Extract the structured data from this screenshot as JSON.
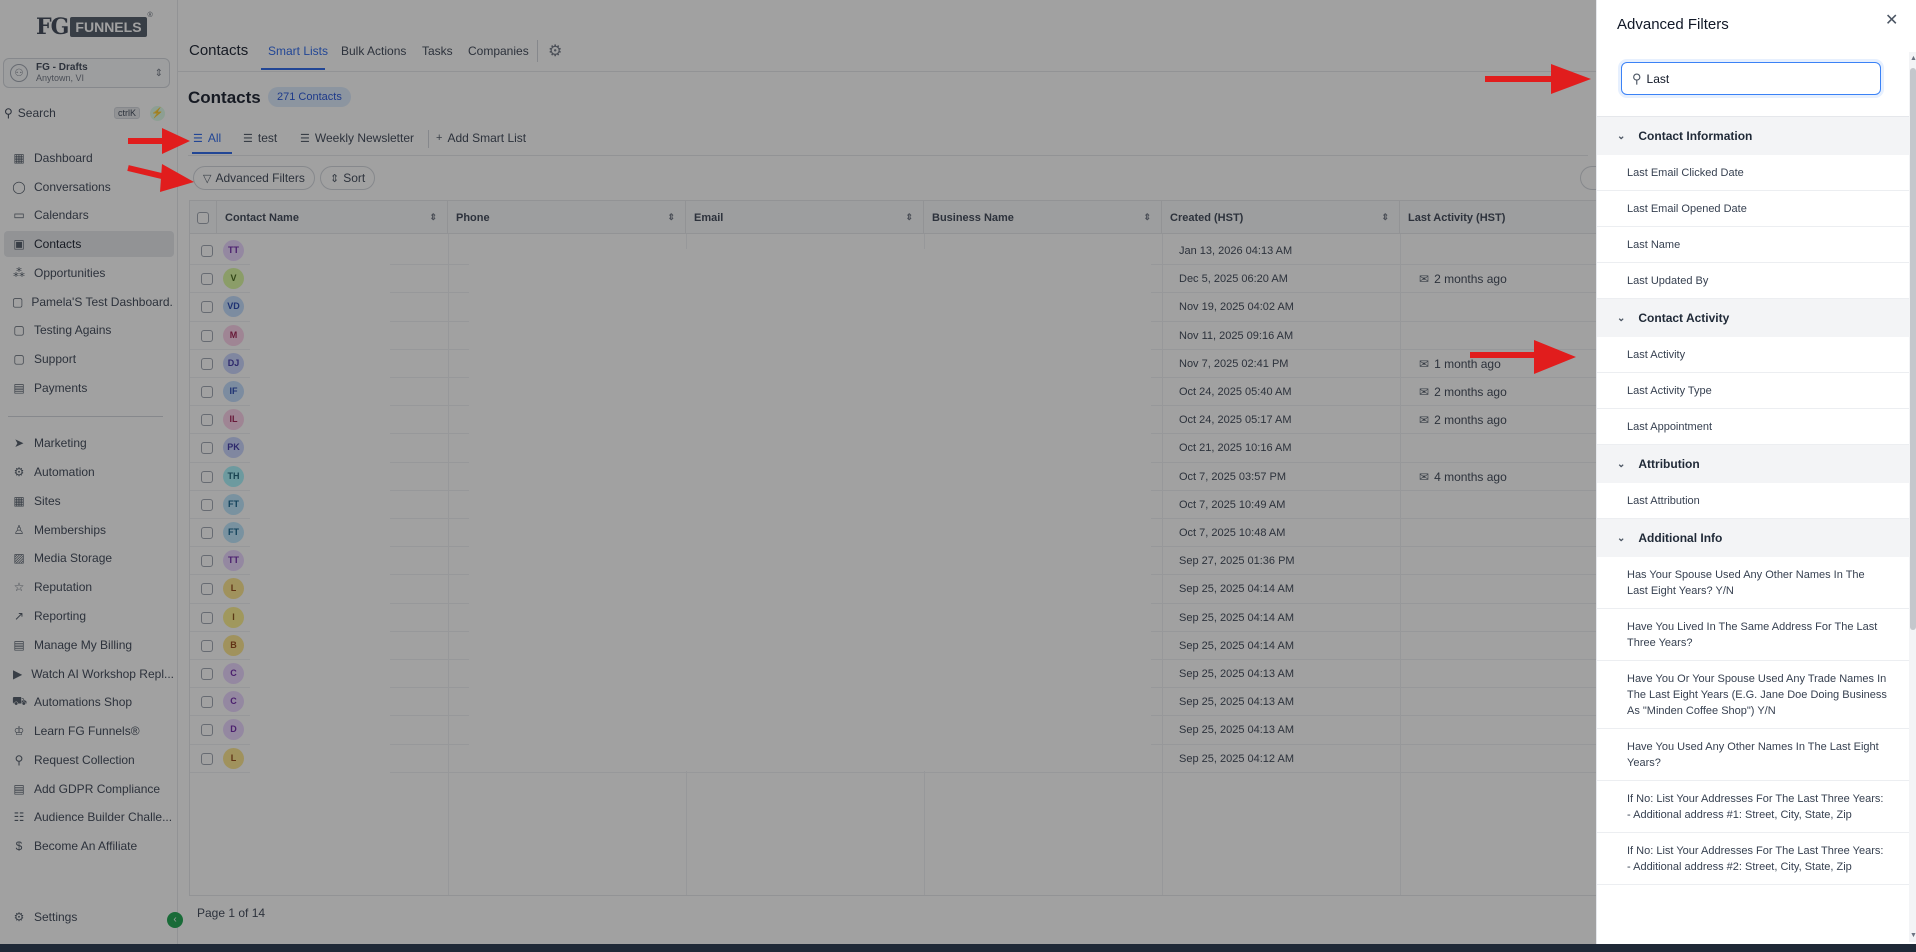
{
  "app": {
    "logo_fg": "FG",
    "logo_funnels": "FUNNELS",
    "logo_reg": "®"
  },
  "sidebar": {
    "account": {
      "name": "FG - Drafts",
      "location": "Anytown, VI"
    },
    "search": {
      "label": "Search",
      "shortcut": "ctrlK"
    },
    "items": [
      {
        "label": "Dashboard",
        "icon": "dashboard-icon",
        "glyph": "▦"
      },
      {
        "label": "Conversations",
        "icon": "chat-icon",
        "glyph": "◯"
      },
      {
        "label": "Calendars",
        "icon": "calendar-icon",
        "glyph": "▭"
      },
      {
        "label": "Contacts",
        "icon": "contacts-icon",
        "glyph": "▣"
      },
      {
        "label": "Opportunities",
        "icon": "opportunities-icon",
        "glyph": "⁂"
      },
      {
        "label": "Pamela'S Test Dashboard...",
        "icon": "custom-link-icon",
        "glyph": "▢"
      },
      {
        "label": "Testing Agains",
        "icon": "custom-link-icon",
        "glyph": "▢"
      },
      {
        "label": "Support",
        "icon": "custom-link-icon",
        "glyph": "▢"
      },
      {
        "label": "Payments",
        "icon": "payments-icon",
        "glyph": "▤"
      },
      {
        "label": "Marketing",
        "icon": "send-icon",
        "glyph": "➤"
      },
      {
        "label": "Automation",
        "icon": "automation-icon",
        "glyph": "⚙"
      },
      {
        "label": "Sites",
        "icon": "sites-icon",
        "glyph": "▦"
      },
      {
        "label": "Memberships",
        "icon": "memberships-icon",
        "glyph": "♙"
      },
      {
        "label": "Media Storage",
        "icon": "image-icon",
        "glyph": "▨"
      },
      {
        "label": "Reputation",
        "icon": "star-icon",
        "glyph": "☆"
      },
      {
        "label": "Reporting",
        "icon": "trend-icon",
        "glyph": "↗"
      },
      {
        "label": "Manage My Billing",
        "icon": "billing-icon",
        "glyph": "▤"
      },
      {
        "label": "Watch AI Workshop Repl...",
        "icon": "video-icon",
        "glyph": "▶"
      },
      {
        "label": "Automations Shop",
        "icon": "cart-icon",
        "glyph": "⛟"
      },
      {
        "label": "Learn FG Funnels®",
        "icon": "graduation-icon",
        "glyph": "♔"
      },
      {
        "label": "Request Collection",
        "icon": "location-icon",
        "glyph": "⚲"
      },
      {
        "label": "Add GDPR Compliance",
        "icon": "document-icon",
        "glyph": "▤"
      },
      {
        "label": "Audience Builder Challe...",
        "icon": "audience-icon",
        "glyph": "☷"
      },
      {
        "label": "Become An Affiliate",
        "icon": "dollar-icon",
        "glyph": "$"
      }
    ],
    "settings_label": "Settings"
  },
  "header": {
    "title": "Contacts",
    "tabs": [
      "Smart Lists",
      "Bulk Actions",
      "Tasks",
      "Companies"
    ]
  },
  "main": {
    "page_title": "Contacts",
    "count_badge": "271 Contacts",
    "smart_lists": [
      "All",
      "test",
      "Weekly Newsletter"
    ],
    "add_smart_list": "Add Smart List",
    "advanced_filters": "Advanced Filters",
    "sort": "Sort",
    "columns": [
      "Contact Name",
      "Phone",
      "Email",
      "Business Name",
      "Created (HST)",
      "Last Activity (HST)"
    ],
    "rows": [
      {
        "initials": "TT",
        "created": "Jan 13, 2026 04:13 AM",
        "activity": ""
      },
      {
        "initials": "V",
        "created": "Dec 5, 2025 06:20 AM",
        "activity": "2 months ago"
      },
      {
        "initials": "VD",
        "created": "Nov 19, 2025 04:02 AM",
        "activity": ""
      },
      {
        "initials": "M",
        "created": "Nov 11, 2025 09:16 AM",
        "activity": ""
      },
      {
        "initials": "DJ",
        "created": "Nov 7, 2025 02:41 PM",
        "activity": "1 month ago"
      },
      {
        "initials": "IF",
        "created": "Oct 24, 2025 05:40 AM",
        "activity": "2 months ago"
      },
      {
        "initials": "IL",
        "created": "Oct 24, 2025 05:17 AM",
        "activity": "2 months ago"
      },
      {
        "initials": "PK",
        "created": "Oct 21, 2025 10:16 AM",
        "activity": ""
      },
      {
        "initials": "TH",
        "created": "Oct 7, 2025 03:57 PM",
        "activity": "4 months ago"
      },
      {
        "initials": "FT",
        "created": "Oct 7, 2025 10:49 AM",
        "activity": ""
      },
      {
        "initials": "FT",
        "created": "Oct 7, 2025 10:48 AM",
        "activity": ""
      },
      {
        "initials": "TT",
        "created": "Sep 27, 2025 01:36 PM",
        "activity": ""
      },
      {
        "initials": "L",
        "created": "Sep 25, 2025 04:14 AM",
        "activity": ""
      },
      {
        "initials": "I",
        "created": "Sep 25, 2025 04:14 AM",
        "activity": ""
      },
      {
        "initials": "B",
        "created": "Sep 25, 2025 04:14 AM",
        "activity": ""
      },
      {
        "initials": "C",
        "created": "Sep 25, 2025 04:13 AM",
        "activity": ""
      },
      {
        "initials": "C",
        "created": "Sep 25, 2025 04:13 AM",
        "activity": ""
      },
      {
        "initials": "D",
        "created": "Sep 25, 2025 04:13 AM",
        "activity": ""
      },
      {
        "initials": "L",
        "created": "Sep 25, 2025 04:12 AM",
        "activity": ""
      }
    ],
    "pager": "Page 1 of 14"
  },
  "panel": {
    "title": "Advanced Filters",
    "search_value": "Last",
    "groups": [
      {
        "label": "Contact Information",
        "options": [
          "Last Email Clicked Date",
          "Last Email Opened Date",
          "Last Name",
          "Last Updated By"
        ]
      },
      {
        "label": "Contact Activity",
        "options": [
          "Last Activity",
          "Last Activity Type",
          "Last Appointment"
        ]
      },
      {
        "label": "Attribution",
        "options": [
          "Last Attribution"
        ]
      },
      {
        "label": "Additional Info",
        "options": [
          "Has Your Spouse Used Any Other Names In The Last Eight Years? Y/N",
          "Have You Lived In The Same Address For The Last Three Years?",
          "Have You Or Your Spouse Used Any Trade Names In The Last Eight Years (E.G. Jane Doe Doing Business As \"Minden Coffee Shop\") Y/N",
          "Have You Used Any Other Names In The Last Eight Years?",
          "If No: List Your Addresses For The Last Three Years: - Additional address #1: Street, City, State, Zip",
          "If No: List Your Addresses For The Last Three Years: - Additional address #2: Street, City, State, Zip"
        ]
      }
    ]
  },
  "colors": {
    "accent": "#2563eb",
    "annotation_arrow": "#e11d1d",
    "overlay": "rgba(30,30,30,0.42)"
  }
}
